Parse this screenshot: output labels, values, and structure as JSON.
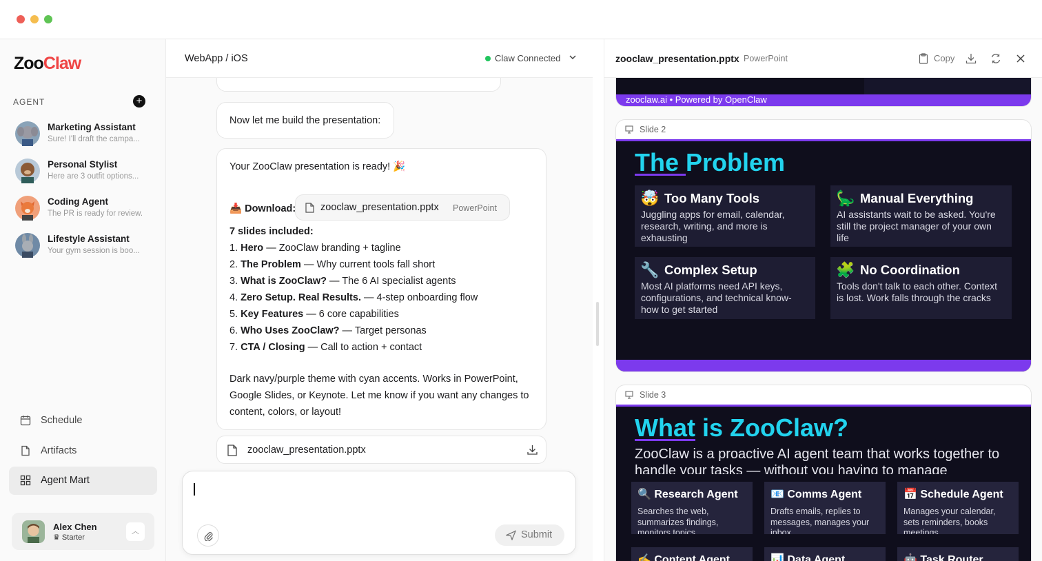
{
  "colors": {
    "accent_cyan": "#22d3ee",
    "accent_purple": "#7c3aed",
    "slide_bg": "#0f0e1c",
    "connected_green": "#22c55e"
  },
  "sidebar": {
    "logo_part1": "Zoo",
    "logo_part2": "Claw",
    "agent_section_label": "AGENT",
    "agents": [
      {
        "name": "Marketing Assistant",
        "preview": "Sure! I'll draft the campa..."
      },
      {
        "name": "Personal Stylist",
        "preview": "Here are 3 outfit options..."
      },
      {
        "name": "Coding Agent",
        "preview": "The PR is ready for review."
      },
      {
        "name": "Lifestyle Assistant",
        "preview": "Your gym session is boo..."
      }
    ],
    "nav": [
      {
        "label": "Schedule",
        "icon": "calendar-icon"
      },
      {
        "label": "Artifacts",
        "icon": "file-icon"
      },
      {
        "label": "Agent Mart",
        "icon": "grid-icon"
      }
    ],
    "user": {
      "name": "Alex Chen",
      "plan": "Starter"
    }
  },
  "chat": {
    "title": "WebApp / iOS",
    "connection_status": "Claw Connected",
    "messages": {
      "build_msg": "Now let me build the presentation:",
      "ready_msg": "Your ZooClaw presentation is ready! 🎉",
      "download_label": "Download:",
      "file_name": "zooclaw_presentation.pptx",
      "file_type": "PowerPoint",
      "slides_heading": "7 slides included:",
      "slides": [
        {
          "num": "1.",
          "name": "Hero",
          "desc": " — ZooClaw branding + tagline"
        },
        {
          "num": "2.",
          "name": "The Problem",
          "desc": " — Why current tools fall short"
        },
        {
          "num": "3.",
          "name": "What is ZooClaw?",
          "desc": " — The 6 AI specialist agents"
        },
        {
          "num": "4.",
          "name": "Zero Setup. Real Results.",
          "desc": " — 4-step onboarding flow"
        },
        {
          "num": "5.",
          "name": "Key Features",
          "desc": " — 6 core capabilities"
        },
        {
          "num": "6.",
          "name": "Who Uses ZooClaw?",
          "desc": " — Target personas"
        },
        {
          "num": "7.",
          "name": "CTA / Closing",
          "desc": " — Call to action + contact"
        }
      ],
      "closing_line1": "Dark navy/purple theme with cyan accents. Works in PowerPoint,",
      "closing_line2": "Google Slides, or Keynote. Let me know if you want any changes to",
      "closing_line3": "content, colors, or layout!"
    },
    "attachment_name": "zooclaw_presentation.pptx",
    "composer": {
      "submit_label": "Submit"
    }
  },
  "preview": {
    "file_name": "zooclaw_presentation.pptx",
    "file_type": "PowerPoint",
    "copy_label": "Copy",
    "slide1_footer": "zooclaw.ai • Powered by OpenClaw",
    "slide2": {
      "label": "Slide 2",
      "title_a": "The ",
      "title_b": "Problem",
      "cards": [
        {
          "emoji": "🤯",
          "title": "Too Many Tools",
          "body": "Juggling apps for email, calendar, research, writing, and more is exhausting"
        },
        {
          "emoji": "🦕",
          "title": "Manual Everything",
          "body": "AI assistants wait to be asked. You're still the project manager of your own life"
        },
        {
          "emoji": "🔧",
          "title": "Complex Setup",
          "body": "Most AI platforms need API keys, configurations, and technical know-how to get started"
        },
        {
          "emoji": "🧩",
          "title": "No Coordination",
          "body": "Tools don't talk to each other. Context is lost. Work falls through the cracks"
        }
      ]
    },
    "slide3": {
      "label": "Slide 3",
      "title_a": "What",
      "title_b": " is ZooClaw?",
      "subtitle": "ZooClaw is a proactive AI agent team that works together to handle your tasks — without you having to manage",
      "cards": [
        {
          "title": "🔍 Research Agent",
          "body": "Searches the web, summarizes findings, monitors topics"
        },
        {
          "title": "📧 Comms Agent",
          "body": "Drafts emails, replies to messages, manages your inbox"
        },
        {
          "title": "📅 Schedule Agent",
          "body": "Manages your calendar, sets reminders, books meetings"
        },
        {
          "title": "✍️ Content Agent",
          "body": ""
        },
        {
          "title": "📊 Data Agent",
          "body": ""
        },
        {
          "title": "🤖 Task Router",
          "body": ""
        }
      ]
    }
  }
}
